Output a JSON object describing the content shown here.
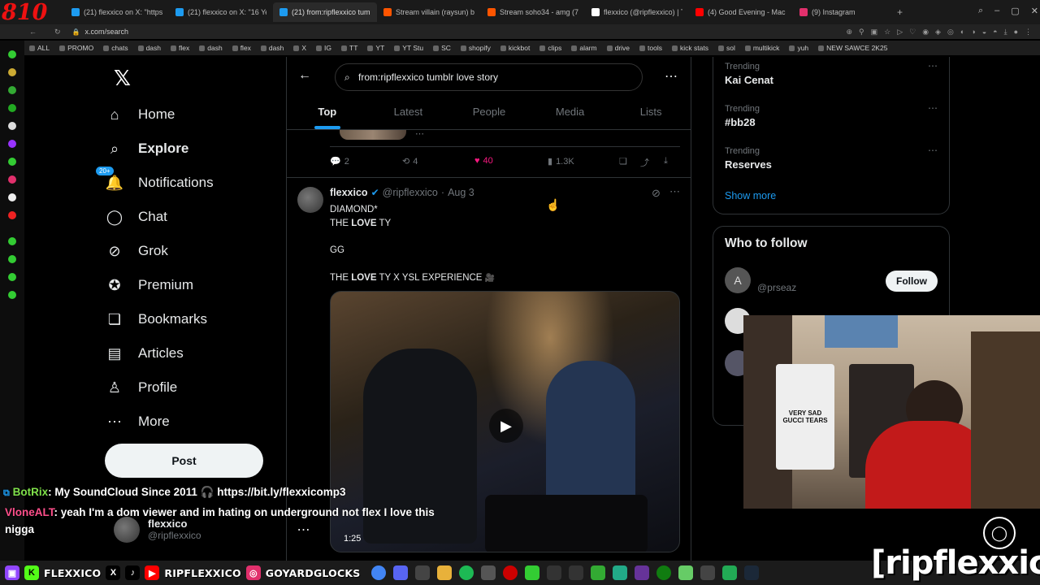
{
  "browser": {
    "corner_number": "810",
    "tabs": [
      {
        "title": "(21) flexxico on X: \"https://",
        "color": "#1d9bf0"
      },
      {
        "title": "(21) flexxico on X: \"16 Year",
        "color": "#1d9bf0"
      },
      {
        "title": "(21) from:ripflexxico tumbl",
        "color": "#1d9bf0",
        "active": true
      },
      {
        "title": "Stream villain (raysun) by",
        "color": "#ff5500"
      },
      {
        "title": "Stream soho34 - amg (72",
        "color": "#ff5500"
      },
      {
        "title": "flexxico (@ripflexxico) | Ti",
        "color": "#ffffff"
      },
      {
        "title": "(4) Good Evening - Mac M",
        "color": "#ff0000"
      },
      {
        "title": "(9) Instagram",
        "color": "#e1306c"
      }
    ],
    "url": "x.com/search",
    "bookmarks": [
      "ALL",
      "PROMO",
      "chats",
      "dash",
      "flex",
      "dash",
      "flex",
      "dash",
      "X",
      "IG",
      "TT",
      "YT",
      "YT Stu",
      "SC",
      "shopify",
      "kickbot",
      "clips",
      "alarm",
      "drive",
      "tools",
      "kick stats",
      "sol",
      "multikick",
      "yuh",
      "NEW SAWCE 2K25"
    ]
  },
  "nav": {
    "items": [
      {
        "label": "Home",
        "icon": "home-icon",
        "glyph": "⌂"
      },
      {
        "label": "Explore",
        "icon": "search-icon",
        "glyph": "⌕",
        "bold": true
      },
      {
        "label": "Notifications",
        "icon": "bell-icon",
        "glyph": "🔔",
        "badge": "20+"
      },
      {
        "label": "Chat",
        "icon": "chat-icon",
        "glyph": "◯"
      },
      {
        "label": "Grok",
        "icon": "grok-icon",
        "glyph": "⊘"
      },
      {
        "label": "Premium",
        "icon": "premium-icon",
        "glyph": "✪"
      },
      {
        "label": "Bookmarks",
        "icon": "bookmark-icon",
        "glyph": "❏"
      },
      {
        "label": "Articles",
        "icon": "articles-icon",
        "glyph": "▤"
      },
      {
        "label": "Profile",
        "icon": "profile-icon",
        "glyph": "♙"
      },
      {
        "label": "More",
        "icon": "more-icon",
        "glyph": "⋯"
      }
    ],
    "post_label": "Post",
    "account_name": "flexxico",
    "account_handle": "@ripflexxico"
  },
  "search": {
    "query": "from:ripflexxico tumblr love story"
  },
  "tabs": [
    "Top",
    "Latest",
    "People",
    "Media",
    "Lists"
  ],
  "prev_tweet": {
    "replies": "2",
    "reposts": "4",
    "likes": "40",
    "views": "1.3K"
  },
  "tweet": {
    "name": "flexxico",
    "handle": "@ripflexxico",
    "date": "Aug 3",
    "line1": "DIAMOND*",
    "line2_pre": "THE ",
    "line2_bold": "LOVE",
    "line2_post": " TY",
    "line3": "GG",
    "line4_pre": "THE ",
    "line4_bold": "LOVE",
    "line4_post": " TY X YSL EXPERIENCE",
    "video_duration": "1:25"
  },
  "trends": [
    {
      "label": "Trending",
      "name": "Kai Cenat"
    },
    {
      "label": "Trending",
      "name": "#bb28"
    },
    {
      "label": "Trending",
      "name": "Reserves"
    }
  ],
  "show_more": "Show more",
  "who_to_follow": {
    "title": "Who to follow",
    "handle": "@prseaz",
    "avatar_letter": "A",
    "follow_label": "Follow"
  },
  "chat_overlay": {
    "user1": "BotRix",
    "msg1": ": My SoundCloud Since 2011 🎧 https://bit.ly/flexxicomp3",
    "user2": "VloneALT",
    "msg2": ": yeah I'm a dom viewer and im hating on underground not flex I love this nigga"
  },
  "taskbar": {
    "labels": [
      "FLEXXICO",
      "RIPFLEXXICO",
      "GOYARDGLOCKS"
    ],
    "watermark": "[ripflexxico]"
  },
  "webcam_shirt_text": "VERY SAD GUCCI TEARS"
}
